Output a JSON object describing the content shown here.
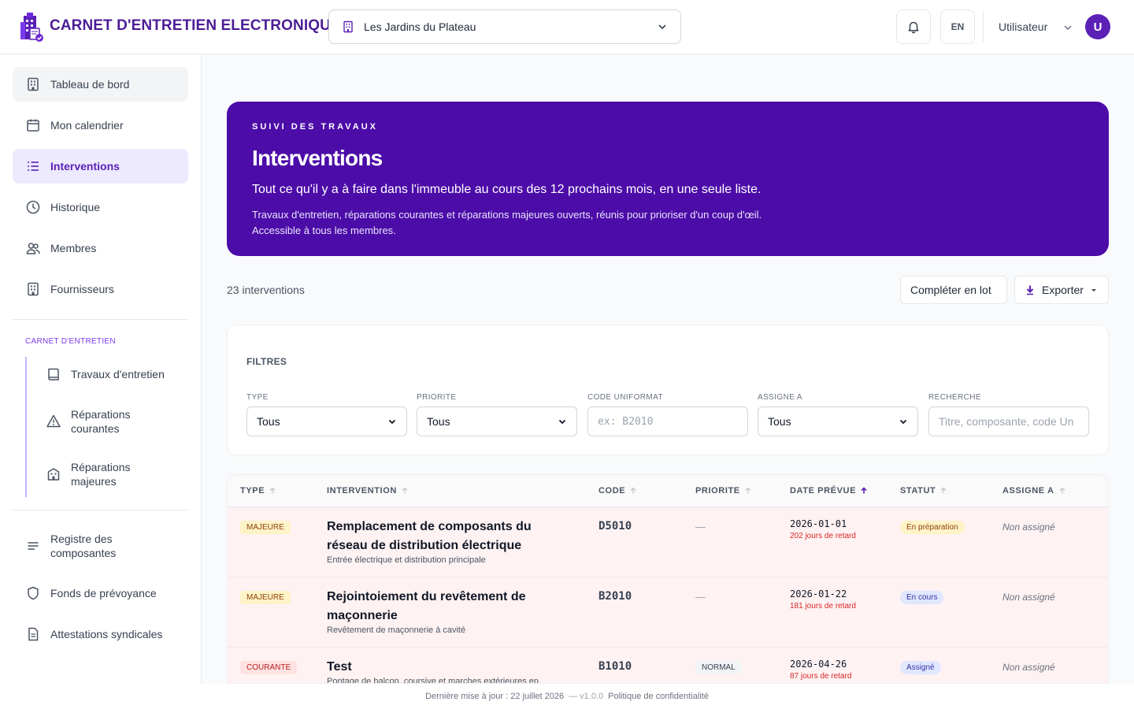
{
  "header": {
    "app_title": "CARNET D'ENTRETIEN ELECTRONIQUE",
    "building": "Les Jardins du Plateau",
    "language": "EN",
    "user_name": "Utilisateur",
    "avatar_initial": "U"
  },
  "sidebar": {
    "items": [
      {
        "label": "Tableau de bord",
        "icon": "building-icon"
      },
      {
        "label": "Mon calendrier",
        "icon": "calendar-icon"
      },
      {
        "label": "Interventions",
        "icon": "list-icon"
      },
      {
        "label": "Historique",
        "icon": "clock-icon"
      },
      {
        "label": "Membres",
        "icon": "users-icon"
      },
      {
        "label": "Fournisseurs",
        "icon": "building-icon"
      }
    ],
    "section_label": "CARNET D'ENTRETIEN",
    "sub_items": [
      {
        "label": "Travaux d'entretien",
        "icon": "book-icon"
      },
      {
        "label": "Réparations courantes",
        "icon": "warning-icon"
      },
      {
        "label": "Réparations majeures",
        "icon": "building-alert-icon"
      }
    ],
    "bottom_items": [
      {
        "label": "Registre des composantes",
        "icon": "lines-icon"
      },
      {
        "label": "Fonds de prévoyance",
        "icon": "shield-icon"
      },
      {
        "label": "Attestations syndicales",
        "icon": "document-icon"
      }
    ]
  },
  "banner": {
    "eyebrow": "SUIVI DES TRAVAUX",
    "title": "Interventions",
    "lead": "Tout ce qu'il y a à faire dans l'immeuble au cours des 12 prochains mois, en une seule liste.",
    "desc_line1": "Travaux d'entretien, réparations courantes et réparations majeures ouverts, réunis pour prioriser d'un coup d'œil.",
    "desc_line2": "Accessible à tous les membres."
  },
  "toolbar": {
    "count": "23 interventions",
    "bulk_label": "Compléter en lot",
    "export_label": "Exporter"
  },
  "filters": {
    "title": "FILTRES",
    "type_label": "TYPE",
    "type_value": "Tous",
    "priority_label": "PRIORITE",
    "priority_value": "Tous",
    "code_label": "CODE UNIFORMAT",
    "code_placeholder": "ex: B2010",
    "assignee_label": "ASSIGNE A",
    "assignee_value": "Tous",
    "search_label": "RECHERCHE",
    "search_placeholder": "Titre, composante, code Un"
  },
  "table": {
    "columns": [
      "TYPE",
      "INTERVENTION",
      "CODE",
      "PRIORITE",
      "DATE PRÉVUE",
      "STATUT",
      "ASSIGNE A"
    ],
    "rows": [
      {
        "type": "MAJEURE",
        "title": "Remplacement de composants du réseau de distribution électrique",
        "subtitle": "Entrée électrique et distribution principale",
        "code": "D5010",
        "priority": "—",
        "date": "2026-01-01",
        "late": "202 jours de retard",
        "status": "En préparation",
        "assignee": "Non assigné"
      },
      {
        "type": "MAJEURE",
        "title": "Rejointoiement du revêtement de maçonnerie",
        "subtitle": "Revêtement de maçonnerie à cavité",
        "code": "B2010",
        "priority": "—",
        "date": "2026-01-22",
        "late": "181 jours de retard",
        "status": "En cours",
        "assignee": "Non assigné"
      },
      {
        "type": "COURANTE",
        "title": "Test",
        "subtitle": "Pontage de balcon, coursive et marches extérieures en",
        "code": "B1010",
        "priority": "NORMAL",
        "date": "2026-04-26",
        "late": "87 jours de retard",
        "status": "Assigné",
        "assignee": "Non assigné"
      }
    ]
  },
  "footer": {
    "updated": "Dernière mise à jour : 22 juillet 2026",
    "version": "— v1.0.0",
    "privacy": "Politique de confidentialité"
  },
  "colors": {
    "brand": "#4c0ca8",
    "accent": "#5b21b6",
    "late": "#dc2626"
  }
}
